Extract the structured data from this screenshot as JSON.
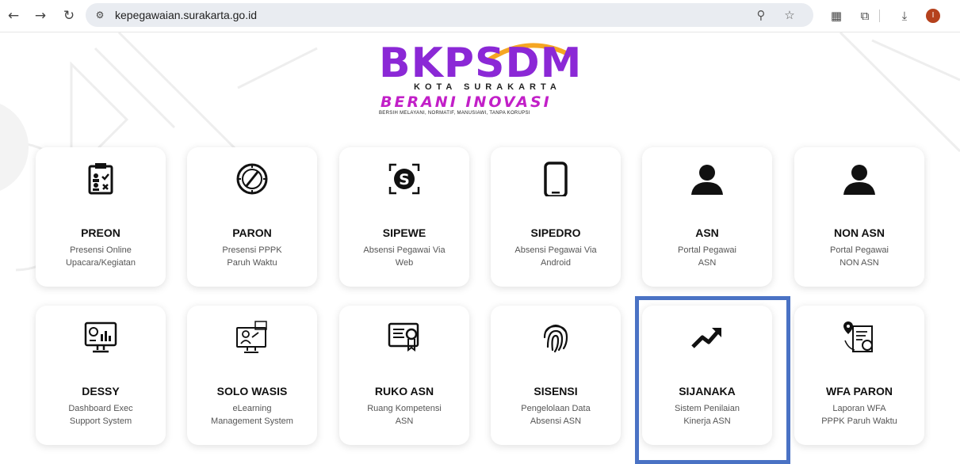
{
  "browser": {
    "url": "kepegawaian.surakarta.go.id",
    "profile_initial": "I"
  },
  "logo": {
    "word": "BKPSDM",
    "subtitle": "KOTA SURAKARTA",
    "tagline": "BERANI INOVASI",
    "motto": "BERSIH MELAYANI, NORMATIF, MANUSIAWI, TANPA KORUPSI"
  },
  "cards": [
    {
      "title": "PREON",
      "desc": "Presensi Online\nUpacara/Kegiatan",
      "icon": "clipboard-checklist-icon"
    },
    {
      "title": "PARON",
      "desc": "Presensi PPPK\nParuh Waktu",
      "icon": "compass-clock-icon"
    },
    {
      "title": "SIPEWE",
      "desc": "Absensi Pegawai Via\nWeb",
      "icon": "scan-s-icon"
    },
    {
      "title": "SIPEDRO",
      "desc": "Absensi Pegawai Via\nAndroid",
      "icon": "smartphone-icon"
    },
    {
      "title": "ASN",
      "desc": "Portal Pegawai\nASN",
      "icon": "user-icon"
    },
    {
      "title": "NON ASN",
      "desc": "Portal Pegawai\nNON ASN",
      "icon": "user-icon"
    },
    {
      "title": "DESSY",
      "desc": "Dashboard Exec\nSupport System",
      "icon": "monitor-dashboard-icon"
    },
    {
      "title": "SOLO WASIS",
      "desc": "eLearning\nManagement System",
      "icon": "elearning-icon"
    },
    {
      "title": "RUKO ASN",
      "desc": "Ruang Kompetensi\nASN",
      "icon": "certificate-icon"
    },
    {
      "title": "SISENSI",
      "desc": "Pengelolaan Data\nAbsensi ASN",
      "icon": "fingerprint-icon"
    },
    {
      "title": "SIJANAKA",
      "desc": "Sistem Penilaian\nKinerja ASN",
      "icon": "trending-up-icon"
    },
    {
      "title": "WFA PARON",
      "desc": "Laporan WFA\nPPPK Paruh Waktu",
      "icon": "location-document-icon"
    }
  ]
}
